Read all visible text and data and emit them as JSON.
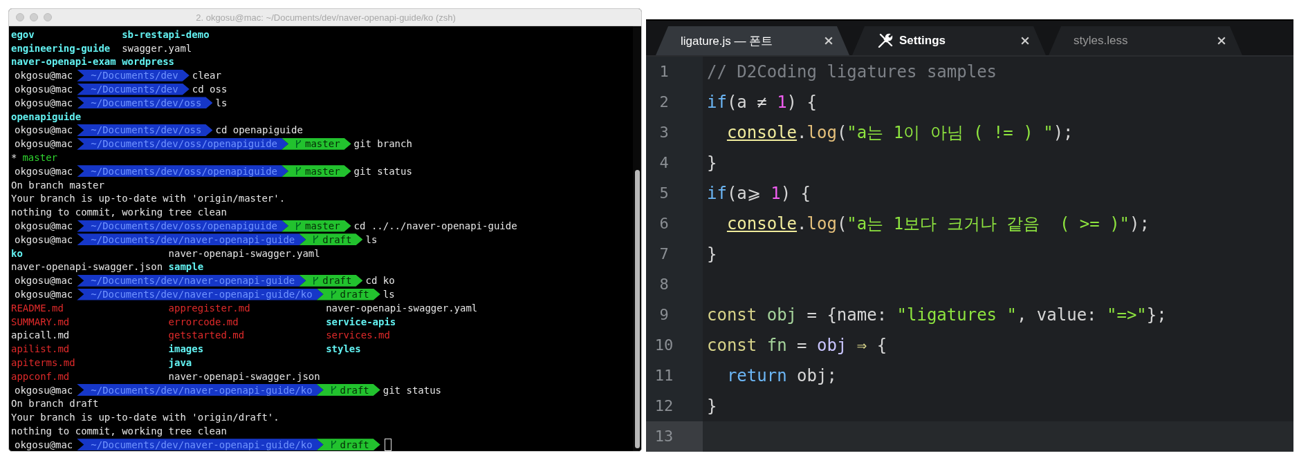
{
  "terminal": {
    "title": "2. okgosu@mac: ~/Documents/dev/naver-openapi-guide/ko (zsh)",
    "lines": [
      {
        "kind": "listing",
        "columns": [
          [
            {
              "name": "egov",
              "kind": "dir"
            },
            {
              "name": "engineering-guide",
              "kind": "dir"
            },
            {
              "name": "naver-openapi-exam",
              "kind": "dir"
            }
          ],
          [
            {
              "name": "sb-restapi-demo",
              "kind": "dir"
            },
            {
              "name": "swagger.yaml",
              "kind": "file"
            },
            {
              "name": "wordpress",
              "kind": "dir"
            }
          ]
        ]
      },
      {
        "kind": "prompt",
        "user": "okgosu@mac",
        "path": "~/Documents/dev",
        "command": "clear"
      },
      {
        "kind": "prompt",
        "user": "okgosu@mac",
        "path": "~/Documents/dev",
        "command": "cd oss"
      },
      {
        "kind": "prompt",
        "user": "okgosu@mac",
        "path": "~/Documents/dev/oss",
        "command": "ls"
      },
      {
        "kind": "listing",
        "columns": [
          [
            {
              "name": "openapiguide",
              "kind": "dir"
            }
          ]
        ]
      },
      {
        "kind": "prompt",
        "user": "okgosu@mac",
        "path": "~/Documents/dev/oss",
        "command": "cd openapiguide"
      },
      {
        "kind": "prompt",
        "user": "okgosu@mac",
        "path": "~/Documents/dev/oss/openapiguide",
        "branch": "master",
        "command": "git branch"
      },
      {
        "kind": "branch",
        "marker": "*",
        "name": "master"
      },
      {
        "kind": "prompt",
        "user": "okgosu@mac",
        "path": "~/Documents/dev/oss/openapiguide",
        "branch": "master",
        "command": "git status"
      },
      {
        "kind": "text",
        "text": "On branch master"
      },
      {
        "kind": "text",
        "text": "Your branch is up-to-date with 'origin/master'."
      },
      {
        "kind": "text",
        "text": "nothing to commit, working tree clean"
      },
      {
        "kind": "prompt",
        "user": "okgosu@mac",
        "path": "~/Documents/dev/oss/openapiguide",
        "branch": "master",
        "command": "cd ../../naver-openapi-guide"
      },
      {
        "kind": "prompt",
        "user": "okgosu@mac",
        "path": "~/Documents/dev/naver-openapi-guide",
        "branch": "draft",
        "command": "ls"
      },
      {
        "kind": "listing",
        "columns": [
          [
            {
              "name": "ko",
              "kind": "dir"
            },
            {
              "name": "naver-openapi-swagger.json",
              "kind": "file"
            }
          ],
          [
            {
              "name": "naver-openapi-swagger.yaml",
              "kind": "file"
            },
            {
              "name": "sample",
              "kind": "dir"
            }
          ]
        ]
      },
      {
        "kind": "prompt",
        "user": "okgosu@mac",
        "path": "~/Documents/dev/naver-openapi-guide",
        "branch": "draft",
        "command": "cd ko"
      },
      {
        "kind": "prompt",
        "user": "okgosu@mac",
        "path": "~/Documents/dev/naver-openapi-guide/ko",
        "branch": "draft",
        "command": "ls"
      },
      {
        "kind": "listing",
        "columns": [
          [
            {
              "name": "README.md",
              "kind": "doc"
            },
            {
              "name": "SUMMARY.md",
              "kind": "doc"
            },
            {
              "name": "apicall.md",
              "kind": "file"
            },
            {
              "name": "apilist.md",
              "kind": "doc"
            },
            {
              "name": "apiterms.md",
              "kind": "doc"
            },
            {
              "name": "appconf.md",
              "kind": "doc"
            }
          ],
          [
            {
              "name": "appregister.md",
              "kind": "doc"
            },
            {
              "name": "errorcode.md",
              "kind": "doc"
            },
            {
              "name": "getstarted.md",
              "kind": "doc"
            },
            {
              "name": "images",
              "kind": "dir"
            },
            {
              "name": "java",
              "kind": "dir"
            },
            {
              "name": "naver-openapi-swagger.json",
              "kind": "file"
            }
          ],
          [
            {
              "name": "naver-openapi-swagger.yaml",
              "kind": "file"
            },
            {
              "name": "service-apis",
              "kind": "dir"
            },
            {
              "name": "services.md",
              "kind": "doc"
            },
            {
              "name": "styles",
              "kind": "dir"
            }
          ]
        ]
      },
      {
        "kind": "prompt",
        "user": "okgosu@mac",
        "path": "~/Documents/dev/naver-openapi-guide/ko",
        "branch": "draft",
        "command": "git status"
      },
      {
        "kind": "text",
        "text": "On branch draft"
      },
      {
        "kind": "text",
        "text": "Your branch is up-to-date with 'origin/draft'."
      },
      {
        "kind": "text",
        "text": "nothing to commit, working tree clean"
      },
      {
        "kind": "prompt",
        "user": "okgosu@mac",
        "path": "~/Documents/dev/naver-openapi-guide/ko",
        "branch": "draft",
        "cursor": true
      }
    ]
  },
  "editor": {
    "tabs": [
      {
        "label": "ligature.js — 폰트",
        "kind": "file",
        "selected": true
      },
      {
        "label": "Settings",
        "kind": "settings",
        "selected": false
      },
      {
        "label": "styles.less",
        "kind": "file",
        "selected": false
      }
    ],
    "lines": [
      {
        "number": "1",
        "tokens": [
          {
            "kind": "comment",
            "text": "// D2Coding ligatures samples"
          }
        ]
      },
      {
        "number": "2",
        "tokens": [
          {
            "kind": "keyword",
            "text": "if"
          },
          {
            "kind": "plain",
            "text": "(a ≠ "
          },
          {
            "kind": "number",
            "text": "1"
          },
          {
            "kind": "plain",
            "text": ") {"
          }
        ]
      },
      {
        "number": "3",
        "tokens": [
          {
            "kind": "builtin",
            "text": "  console"
          },
          {
            "kind": "plain",
            "text": "."
          },
          {
            "kind": "method",
            "text": "log"
          },
          {
            "kind": "plain",
            "text": "("
          },
          {
            "kind": "string",
            "text": "\"a는 1이 아님 ( != ) \""
          },
          {
            "kind": "plain",
            "text": ");"
          }
        ]
      },
      {
        "number": "4",
        "tokens": [
          {
            "kind": "plain",
            "text": "}"
          }
        ]
      },
      {
        "number": "5",
        "tokens": [
          {
            "kind": "keyword",
            "text": "if"
          },
          {
            "kind": "plain",
            "text": "(a⩾ "
          },
          {
            "kind": "number",
            "text": "1"
          },
          {
            "kind": "plain",
            "text": ") {"
          }
        ]
      },
      {
        "number": "6",
        "tokens": [
          {
            "kind": "builtin",
            "text": "  console"
          },
          {
            "kind": "plain",
            "text": "."
          },
          {
            "kind": "method",
            "text": "log"
          },
          {
            "kind": "plain",
            "text": "("
          },
          {
            "kind": "string",
            "text": "\"a는 1보다 크거나 같음  ( >= )\""
          },
          {
            "kind": "plain",
            "text": ");"
          }
        ]
      },
      {
        "number": "7",
        "tokens": [
          {
            "kind": "plain",
            "text": "}"
          }
        ]
      },
      {
        "number": "8"
      },
      {
        "number": "9",
        "tokens": [
          {
            "kind": "storage",
            "text": "const"
          },
          {
            "kind": "variable",
            "text": " obj"
          },
          {
            "kind": "plain",
            "text": " = {name: "
          },
          {
            "kind": "string",
            "text": "\"ligatures \""
          },
          {
            "kind": "plain",
            "text": ", value: "
          },
          {
            "kind": "string",
            "text": "\"=>\""
          },
          {
            "kind": "plain",
            "text": "};"
          }
        ]
      },
      {
        "number": "10",
        "tokens": [
          {
            "kind": "storage",
            "text": "const"
          },
          {
            "kind": "variable",
            "text": " fn"
          },
          {
            "kind": "plain",
            "text": " = "
          },
          {
            "kind": "parameter",
            "text": "obj"
          },
          {
            "kind": "storage",
            "text": " ⇒"
          },
          {
            "kind": "plain",
            "text": " {"
          }
        ]
      },
      {
        "number": "11",
        "tokens": [
          {
            "kind": "keyword",
            "text": "  return"
          },
          {
            "kind": "plain",
            "text": " obj;"
          }
        ]
      },
      {
        "number": "12",
        "tokens": [
          {
            "kind": "plain",
            "text": "}"
          }
        ]
      },
      {
        "number": "13",
        "current": true
      }
    ]
  }
}
